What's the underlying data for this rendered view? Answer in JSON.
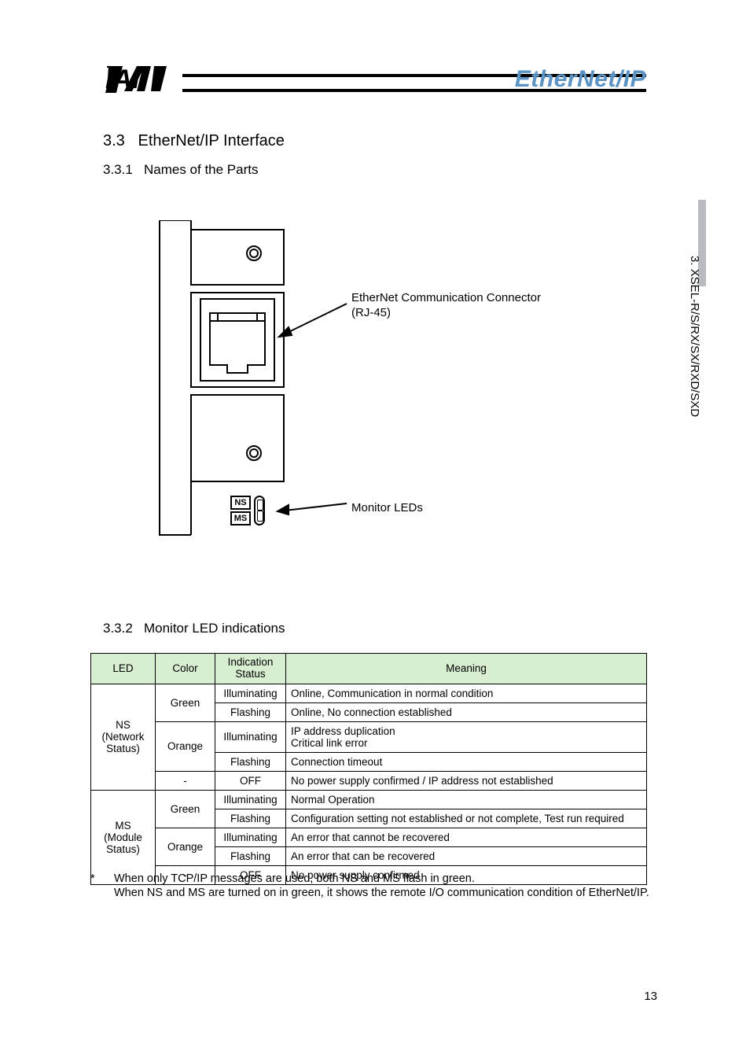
{
  "brand": "EtherNet/IP",
  "side_section": "3. XSEL-R/S/RX/SX/RXD/SXD",
  "page_number": "13",
  "headings": {
    "h1_num": "3.3",
    "h1_title": "EtherNet/IP Interface",
    "h2a_num": "3.3.1",
    "h2a_title": "Names of the Parts",
    "h2b_num": "3.3.2",
    "h2b_title": "Monitor LED indications"
  },
  "diagram": {
    "connector_label_line1": "EtherNet Communication Connector",
    "connector_label_line2": "(RJ-45)",
    "leds_label": "Monitor LEDs",
    "ns_text": "NS",
    "ms_text": "MS"
  },
  "table": {
    "headers": {
      "led": "LED",
      "color": "Color",
      "status": "Indication Status",
      "meaning": "Meaning"
    },
    "groups": [
      {
        "led": "NS\n(Network\nStatus)",
        "rows": [
          {
            "color": "Green",
            "status": "Illuminating",
            "meaning": "Online, Communication in normal condition"
          },
          {
            "color": "",
            "status": "Flashing",
            "meaning": "Online, No connection established"
          },
          {
            "color": "Orange",
            "status": "Illuminating",
            "meaning": "IP address duplication\nCritical link error"
          },
          {
            "color": "",
            "status": "Flashing",
            "meaning": "Connection timeout"
          },
          {
            "color": "-",
            "status": "OFF",
            "meaning": "No power supply confirmed / IP address not established"
          }
        ]
      },
      {
        "led": "MS\n(Module\nStatus)",
        "rows": [
          {
            "color": "Green",
            "status": "Illuminating",
            "meaning": "Normal Operation"
          },
          {
            "color": "",
            "status": "Flashing",
            "meaning": "Configuration setting not established or not complete, Test run required"
          },
          {
            "color": "Orange",
            "status": "Illuminating",
            "meaning": "An error that cannot be recovered"
          },
          {
            "color": "",
            "status": "Flashing",
            "meaning": "An error that can be recovered"
          },
          {
            "color": "-",
            "status": "OFF",
            "meaning": "No power supply confirmed"
          }
        ]
      }
    ]
  },
  "footnote": {
    "star": "*",
    "line1": "When only TCP/IP messages are used, both NS and MS flash in green.",
    "line2": "When NS and MS are turned on in green, it shows the remote I/O communication condition of EtherNet/IP."
  }
}
